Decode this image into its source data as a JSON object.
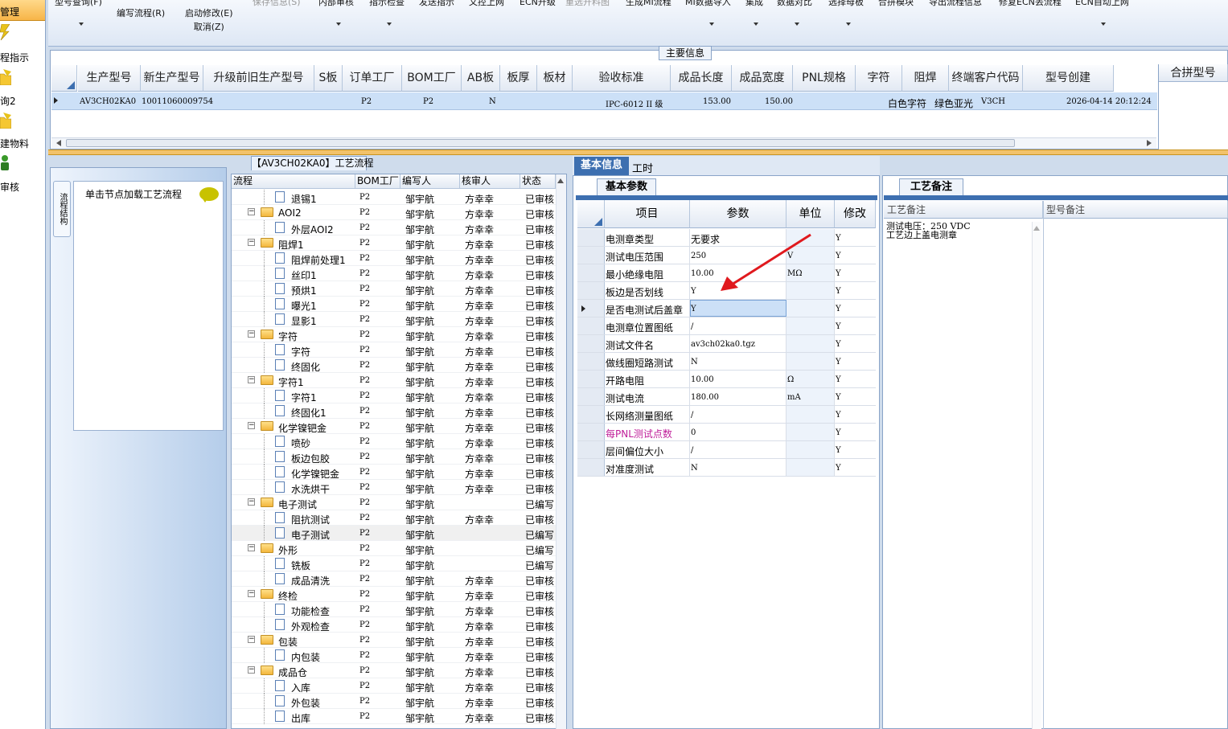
{
  "rail": {
    "header": "管理",
    "items": [
      {
        "label": "程指示",
        "icon": "lightning-icon"
      },
      {
        "label": "询2",
        "icon": "folder-icon"
      },
      {
        "label": "建物料",
        "icon": "folder-icon"
      },
      {
        "label": "审核",
        "icon": "person-icon"
      }
    ]
  },
  "toolbar": {
    "model_query": "型号查询(F)",
    "edit_flow": "编写流程(R)",
    "start_modify": "启动修改(E)",
    "cancel": "取消(Z)",
    "save_info": "保存信息(S)",
    "internal_review": "内部审核",
    "guide_check": "指示检查",
    "publish_guide": "发送指示",
    "cultural_upload": "文控上网",
    "ecn_upgrade": "ECN升级",
    "reselect_material": "重选开料图",
    "gen_mi_flow": "生成MI流程",
    "mi_import": "MI数据导入",
    "compose": "集成",
    "data_compare": "数据对比",
    "select_master": "选择母板",
    "merge_module": "合拼模块",
    "export_flow": "导出流程信息",
    "repair_ecn": "修复ECN丢流程",
    "ecn_auto": "ECN自动上网"
  },
  "main_info": {
    "title": "主要信息",
    "merge_label": "合拼型号",
    "columns": [
      "生产型号",
      "新生产型号",
      "升级前旧生产型号",
      "S板",
      "订单工厂",
      "BOM工厂",
      "AB板",
      "板厚",
      "板材",
      "验收标准",
      "成品长度",
      "成品宽度",
      "PNL规格",
      "字符",
      "阻焊",
      "终端客户代码",
      "型号创建"
    ],
    "row": {
      "prod_no": "AV3CH02KA0",
      "new_prod_no": "10011060009754",
      "order_factory": "P2",
      "bom_factory": "P2",
      "ab_board": "N",
      "standard": "IPC-6012 II 级",
      "length": "153.00",
      "width": "150.00",
      "char": "白色字符",
      "solder": "绿色亚光",
      "customer_code": "V3CH",
      "created": "2026-04-14 20:12:24"
    }
  },
  "process": {
    "tab_title": "【AV3CH02KA0】工艺流程",
    "vtab_label": "流程结构",
    "node_hint": "单击节点加载工艺流程",
    "columns": [
      "流程",
      "BOM工厂",
      "编写人",
      "核审人",
      "状态"
    ],
    "rows": [
      {
        "name": "退锡1",
        "level": 2,
        "bom": "P2",
        "writer": "邹宇航",
        "reviewer": "方幸幸",
        "status": "已审核"
      },
      {
        "name": "AOI2",
        "level": 1,
        "bom": "P2",
        "writer": "邹宇航",
        "reviewer": "方幸幸",
        "status": "已审核"
      },
      {
        "name": "外层AOI2",
        "level": 2,
        "bom": "P2",
        "writer": "邹宇航",
        "reviewer": "方幸幸",
        "status": "已审核"
      },
      {
        "name": "阻焊1",
        "level": 1,
        "bom": "P2",
        "writer": "邹宇航",
        "reviewer": "方幸幸",
        "status": "已审核"
      },
      {
        "name": "阻焊前处理1",
        "level": 2,
        "bom": "P2",
        "writer": "邹宇航",
        "reviewer": "方幸幸",
        "status": "已审核"
      },
      {
        "name": "丝印1",
        "level": 2,
        "bom": "P2",
        "writer": "邹宇航",
        "reviewer": "方幸幸",
        "status": "已审核"
      },
      {
        "name": "预烘1",
        "level": 2,
        "bom": "P2",
        "writer": "邹宇航",
        "reviewer": "方幸幸",
        "status": "已审核"
      },
      {
        "name": "曝光1",
        "level": 2,
        "bom": "P2",
        "writer": "邹宇航",
        "reviewer": "方幸幸",
        "status": "已审核"
      },
      {
        "name": "显影1",
        "level": 2,
        "bom": "P2",
        "writer": "邹宇航",
        "reviewer": "方幸幸",
        "status": "已审核"
      },
      {
        "name": "字符",
        "level": 1,
        "bom": "P2",
        "writer": "邹宇航",
        "reviewer": "方幸幸",
        "status": "已审核"
      },
      {
        "name": "字符",
        "level": 2,
        "bom": "P2",
        "writer": "邹宇航",
        "reviewer": "方幸幸",
        "status": "已审核"
      },
      {
        "name": "终固化",
        "level": 2,
        "bom": "P2",
        "writer": "邹宇航",
        "reviewer": "方幸幸",
        "status": "已审核"
      },
      {
        "name": "字符1",
        "level": 1,
        "bom": "P2",
        "writer": "邹宇航",
        "reviewer": "方幸幸",
        "status": "已审核"
      },
      {
        "name": "字符1",
        "level": 2,
        "bom": "P2",
        "writer": "邹宇航",
        "reviewer": "方幸幸",
        "status": "已审核"
      },
      {
        "name": "终固化1",
        "level": 2,
        "bom": "P2",
        "writer": "邹宇航",
        "reviewer": "方幸幸",
        "status": "已审核"
      },
      {
        "name": "化学镍钯金",
        "level": 1,
        "bom": "P2",
        "writer": "邹宇航",
        "reviewer": "方幸幸",
        "status": "已审核"
      },
      {
        "name": "喷砂",
        "level": 2,
        "bom": "P2",
        "writer": "邹宇航",
        "reviewer": "方幸幸",
        "status": "已审核"
      },
      {
        "name": "板边包胶",
        "level": 2,
        "bom": "P2",
        "writer": "邹宇航",
        "reviewer": "方幸幸",
        "status": "已审核"
      },
      {
        "name": "化学镍钯金",
        "level": 2,
        "bom": "P2",
        "writer": "邹宇航",
        "reviewer": "方幸幸",
        "status": "已审核"
      },
      {
        "name": "水洗烘干",
        "level": 2,
        "bom": "P2",
        "writer": "邹宇航",
        "reviewer": "方幸幸",
        "status": "已审核"
      },
      {
        "name": "电子测试",
        "level": 1,
        "bom": "P2",
        "writer": "邹宇航",
        "reviewer": "",
        "status": "已编写"
      },
      {
        "name": "阻抗测试",
        "level": 2,
        "bom": "P2",
        "writer": "邹宇航",
        "reviewer": "方幸幸",
        "status": "已审核"
      },
      {
        "name": "电子测试",
        "level": 2,
        "bom": "P2",
        "writer": "邹宇航",
        "reviewer": "",
        "status": "已编写",
        "selected": true
      },
      {
        "name": "外形",
        "level": 1,
        "bom": "P2",
        "writer": "邹宇航",
        "reviewer": "",
        "status": "已编写"
      },
      {
        "name": "铣板",
        "level": 2,
        "bom": "P2",
        "writer": "邹宇航",
        "reviewer": "",
        "status": "已编写"
      },
      {
        "name": "成品清洗",
        "level": 2,
        "bom": "P2",
        "writer": "邹宇航",
        "reviewer": "方幸幸",
        "status": "已审核"
      },
      {
        "name": "终检",
        "level": 1,
        "bom": "P2",
        "writer": "邹宇航",
        "reviewer": "方幸幸",
        "status": "已审核"
      },
      {
        "name": "功能检查",
        "level": 2,
        "bom": "P2",
        "writer": "邹宇航",
        "reviewer": "方幸幸",
        "status": "已审核"
      },
      {
        "name": "外观检查",
        "level": 2,
        "bom": "P2",
        "writer": "邹宇航",
        "reviewer": "方幸幸",
        "status": "已审核"
      },
      {
        "name": "包装",
        "level": 1,
        "bom": "P2",
        "writer": "邹宇航",
        "reviewer": "方幸幸",
        "status": "已审核"
      },
      {
        "name": "内包装",
        "level": 2,
        "bom": "P2",
        "writer": "邹宇航",
        "reviewer": "方幸幸",
        "status": "已审核"
      },
      {
        "name": "成品仓",
        "level": 1,
        "bom": "P2",
        "writer": "邹宇航",
        "reviewer": "方幸幸",
        "status": "已审核"
      },
      {
        "name": "入库",
        "level": 2,
        "bom": "P2",
        "writer": "邹宇航",
        "reviewer": "方幸幸",
        "status": "已审核"
      },
      {
        "name": "外包装",
        "level": 2,
        "bom": "P2",
        "writer": "邹宇航",
        "reviewer": "方幸幸",
        "status": "已审核"
      },
      {
        "name": "出库",
        "level": 2,
        "bom": "P2",
        "writer": "邹宇航",
        "reviewer": "方幸幸",
        "status": "已审核"
      }
    ]
  },
  "detail": {
    "tab_basic": "基本信息",
    "tab_hours": "工时",
    "sub_tab": "基本参数",
    "columns": [
      "项目",
      "参数",
      "单位",
      "修改"
    ],
    "rows": [
      {
        "item": "电测章类型",
        "param": "无要求",
        "unit": "",
        "mod": "Y"
      },
      {
        "item": "测试电压范围",
        "param": "250",
        "unit": "V",
        "mod": "Y"
      },
      {
        "item": "最小绝缘电阻",
        "param": "10.00",
        "unit": "MΩ",
        "mod": "Y"
      },
      {
        "item": "板边是否划线",
        "param": "Y",
        "unit": "",
        "mod": "Y"
      },
      {
        "item": "是否电测试后盖章",
        "param": "Y",
        "unit": "",
        "mod": "Y",
        "current": true
      },
      {
        "item": "电测章位置图纸",
        "param": "/",
        "unit": "",
        "mod": "Y"
      },
      {
        "item": "测试文件名",
        "param": "av3ch02ka0.tgz",
        "unit": "",
        "mod": "Y"
      },
      {
        "item": "做线圈短路测试",
        "param": "N",
        "unit": "",
        "mod": "Y"
      },
      {
        "item": "开路电阻",
        "param": "10.00",
        "unit": "Ω",
        "mod": "Y"
      },
      {
        "item": "测试电流",
        "param": "180.00",
        "unit": "mA",
        "mod": "Y"
      },
      {
        "item": "长网络测量图纸",
        "param": "/",
        "unit": "",
        "mod": "Y"
      },
      {
        "item": "每PNL测试点数",
        "param": "0",
        "unit": "",
        "mod": "Y",
        "highlight": true
      },
      {
        "item": "层间偏位大小",
        "param": "/",
        "unit": "",
        "mod": "Y"
      },
      {
        "item": "对准度测试",
        "param": "N",
        "unit": "",
        "mod": "Y"
      }
    ]
  },
  "remarks": {
    "tab": "工艺备注",
    "col_process": "工艺备注",
    "col_model": "型号备注",
    "note": "测试电压：250 VDC\n工艺边上盖电测章"
  },
  "colors": {
    "accent": "#3d6fb0",
    "highlight_text": "#c0209a",
    "arrow": "#e0191e",
    "selection": "#cce0f7"
  }
}
